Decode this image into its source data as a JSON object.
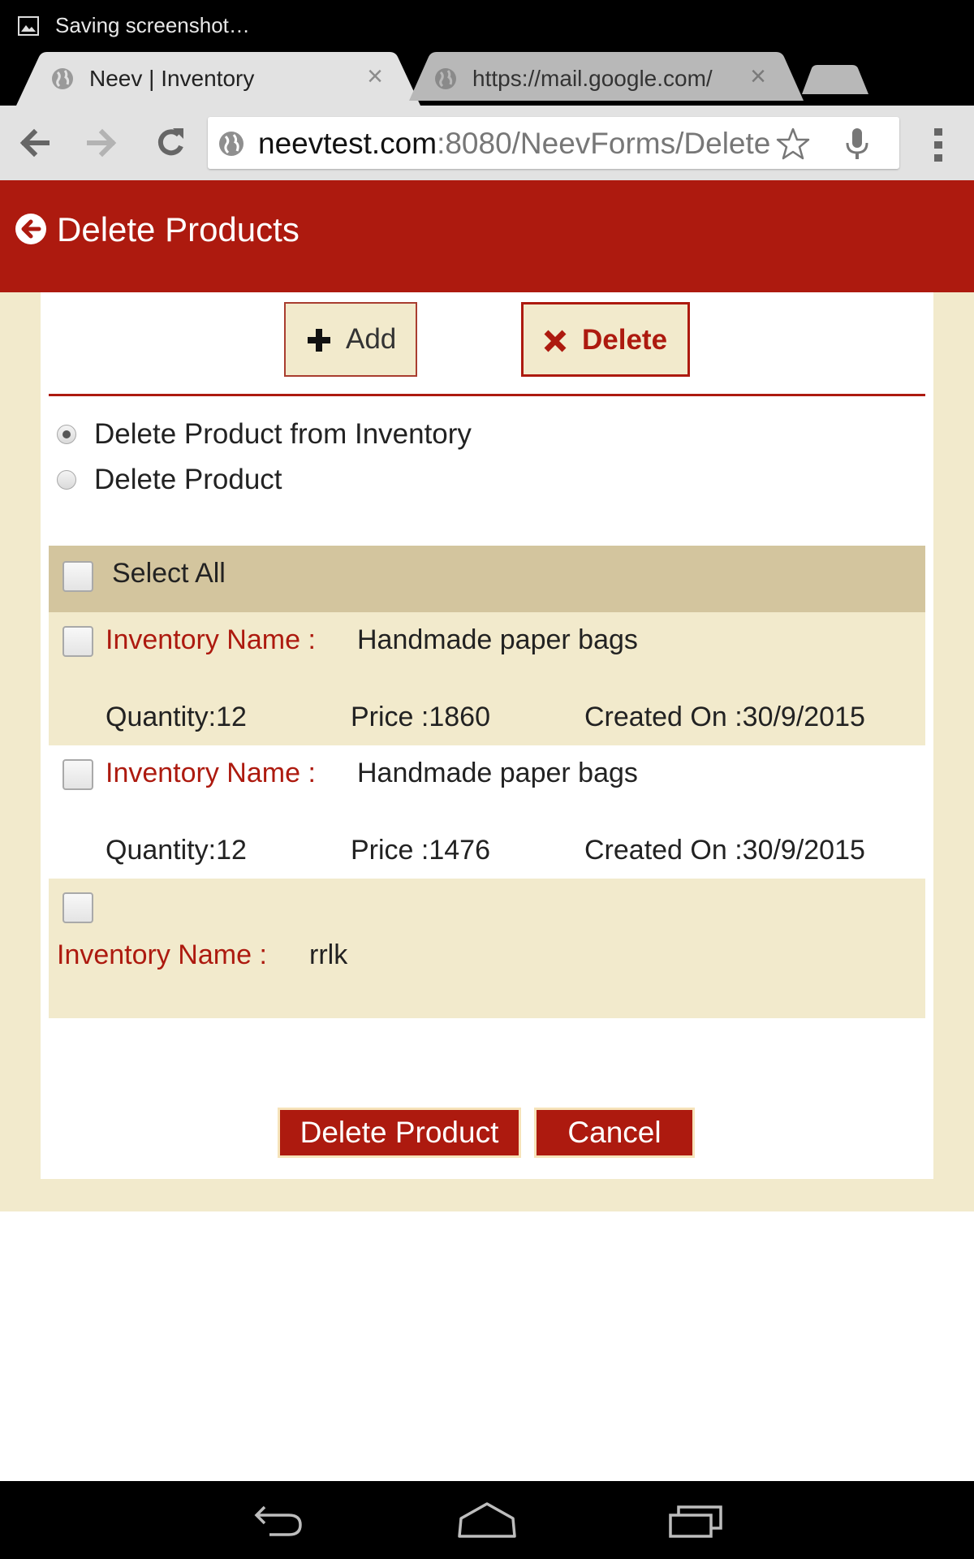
{
  "status_bar": {
    "text": "Saving screenshot…",
    "icon": "image-icon"
  },
  "tabs": [
    {
      "title": "Neev | Inventory",
      "active": true,
      "icon": "globe-icon",
      "close": "×"
    },
    {
      "title": "https://mail.google.com/",
      "active": false,
      "icon": "globe-icon",
      "close": "×"
    }
  ],
  "omnibox": {
    "host": "neevtest.com",
    "path": ":8080/NeevForms/Delete"
  },
  "header": {
    "title": "Delete Products",
    "color": "#ad1a0f"
  },
  "mode_buttons": {
    "add": "Add",
    "delete": "Delete"
  },
  "delete_options": [
    {
      "label": "Delete Product from Inventory",
      "selected": true
    },
    {
      "label": "Delete Product",
      "selected": false
    }
  ],
  "select_all": {
    "label": "Select All",
    "checked": false
  },
  "items": [
    {
      "name_label": "Inventory Name :",
      "name": "Handmade paper bags",
      "quantity": "Quantity:12",
      "price": "Price :1860",
      "created": "Created On :30/9/2015"
    },
    {
      "name_label": "Inventory Name :",
      "name": "Handmade paper bags",
      "quantity": "Quantity:12",
      "price": "Price :1476",
      "created": "Created On :30/9/2015"
    },
    {
      "name_label": "Inventory Name :",
      "name": "rrlk"
    }
  ],
  "actions": {
    "delete_product": "Delete Product",
    "cancel": "Cancel"
  },
  "colors": {
    "accent": "#ad1a0f",
    "cream": "#f2eacc",
    "header_row": "#d3c59e"
  }
}
